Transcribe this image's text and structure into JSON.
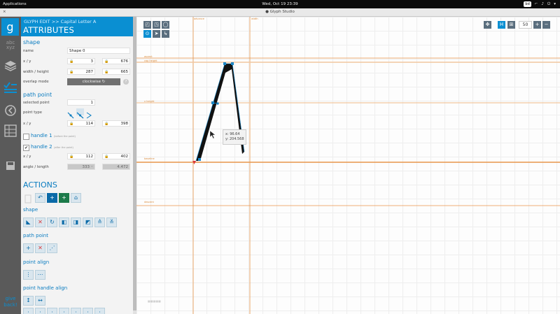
{
  "system": {
    "applications": "Applications",
    "clock": "Wed, Oct 19   23:39",
    "tray_chip": "bd",
    "tray_icons": [
      "⌐",
      "♪",
      "⏻",
      "▾"
    ]
  },
  "window": {
    "title": "● Glyph Studio",
    "close": "×"
  },
  "sidebar_nav": {
    "logo": "g",
    "items": [
      "abc",
      "layers",
      "attributes",
      "history",
      "guides",
      "save"
    ],
    "give_back": [
      "give",
      "back!"
    ]
  },
  "panel": {
    "breadcrumb": "GLYPH EDIT  >>  Capital Letter A",
    "heading": "ATTRIBUTES",
    "shape_section": "shape",
    "name_label": "name",
    "name_value": "Shape 0",
    "xy_label": "x  /  y",
    "x_value": "3",
    "y_value": "676",
    "wh_label": "width  /  height",
    "width_value": "287",
    "height_value": "665",
    "overlap_label": "overlap mode",
    "overlap_value": "clockwise  ↻",
    "help": "?",
    "path_section": "path point",
    "selected_label": "selected point",
    "selected_value": "1",
    "pointtype_label": "point type",
    "pt_x_value": "114",
    "pt_y_value": "398",
    "handle1_label": "handle 1",
    "handle1_hint": "(before the point)",
    "handle2_label": "handle 2",
    "handle2_hint": "(after the point)",
    "h2_x_value": "112",
    "h2_y_value": "402",
    "angle_label": "angle  /  length",
    "angle_value": "333 ◦",
    "length_value": "4.472",
    "actions_heading": "ACTIONS",
    "shape_actions_label": "shape",
    "path_actions_label": "path point",
    "point_align_label": "point align",
    "handle_align_label": "point handle align"
  },
  "canvas": {
    "zoom": "50",
    "guides": {
      "advance": "advance",
      "ascent": "ascent",
      "cap": "cap height",
      "xheight": "x height",
      "baseline": "baseline",
      "descent": "descent",
      "width": "width"
    },
    "tooltip": {
      "x": "x: 96.64",
      "y": "y: 204.568"
    }
  },
  "colors": {
    "accent": "#0a8fd2",
    "guide": "#e8954a"
  }
}
